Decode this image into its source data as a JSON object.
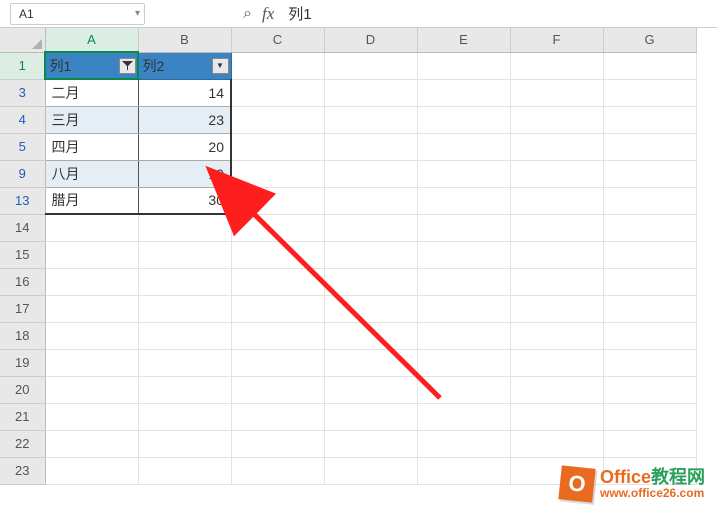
{
  "formula_bar": {
    "name_box": "A1",
    "fx_label": "fx",
    "formula_value": "列1"
  },
  "columns": [
    "A",
    "B",
    "C",
    "D",
    "E",
    "F",
    "G"
  ],
  "row_headers": [
    1,
    3,
    4,
    5,
    9,
    13,
    14,
    15,
    16,
    17,
    18,
    19,
    20,
    21,
    22,
    23
  ],
  "active_cell": "A1",
  "table": {
    "headers": {
      "col1": "列1",
      "col2": "列2"
    },
    "rows": [
      {
        "row_num": 3,
        "col1": "二月",
        "col2": 14
      },
      {
        "row_num": 4,
        "col1": "三月",
        "col2": 23
      },
      {
        "row_num": 5,
        "col1": "四月",
        "col2": 20
      },
      {
        "row_num": 9,
        "col1": "八月",
        "col2": 19
      },
      {
        "row_num": 13,
        "col1": "腊月",
        "col2": 30
      }
    ]
  },
  "watermark": {
    "logo_letter": "O",
    "title_part1": "Office",
    "title_part2": "教程网",
    "url": "www.office26.com"
  }
}
